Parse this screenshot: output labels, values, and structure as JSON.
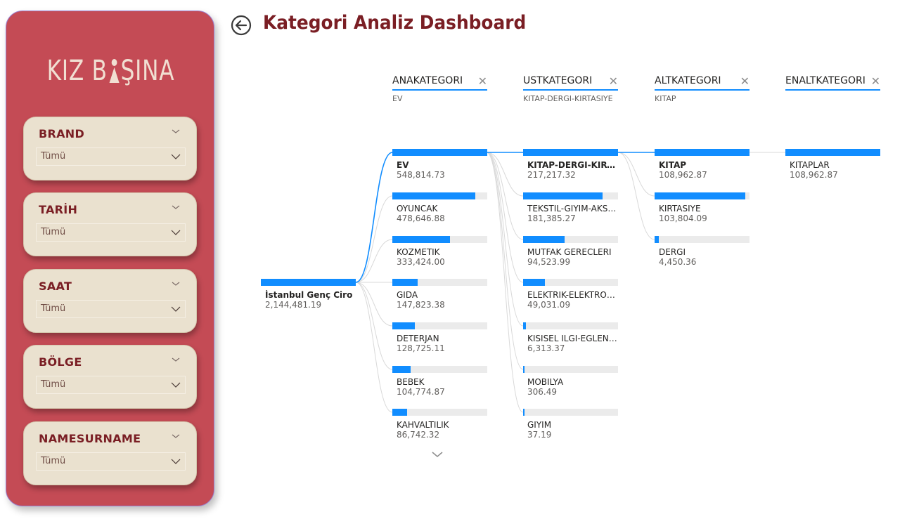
{
  "sidebar": {
    "logo_text_left": "KIZ B",
    "logo_text_right": "ŞINA",
    "slicers": [
      {
        "title": "BRAND",
        "value": "Tümü"
      },
      {
        "title": "TARİH",
        "value": "Tümü"
      },
      {
        "title": "SAAT",
        "value": "Tümü"
      },
      {
        "title": "BÖLGE",
        "value": "Tümü"
      },
      {
        "title": "NAMESURNAME",
        "value": "Tümü"
      }
    ]
  },
  "header": {
    "title": "Kategori Analiz Dashboard"
  },
  "tree": {
    "root": {
      "label": "İstanbul Genç Ciro",
      "value": "2,144,481.19",
      "fill": 1.0
    },
    "levels": [
      {
        "name": "ANAKATEGORI",
        "selected": "EV"
      },
      {
        "name": "USTKATEGORI",
        "selected": "KITAP-DERGI-KIRTASIYE"
      },
      {
        "name": "ALTKATEGORI",
        "selected": "KITAP"
      },
      {
        "name": "ENALTKATEGORI",
        "selected": ""
      }
    ],
    "ana": [
      {
        "label": "EV",
        "value": "548,814.73",
        "fill": 1.0,
        "selected": true
      },
      {
        "label": "OYUNCAK",
        "value": "478,646.88",
        "fill": 0.872
      },
      {
        "label": "KOZMETIK",
        "value": "333,424.00",
        "fill": 0.608
      },
      {
        "label": "GIDA",
        "value": "147,823.38",
        "fill": 0.269
      },
      {
        "label": "DETERJAN",
        "value": "128,725.11",
        "fill": 0.235
      },
      {
        "label": "BEBEK",
        "value": "104,774.87",
        "fill": 0.191
      },
      {
        "label": "KAHVALTILIK",
        "value": "86,742.32",
        "fill": 0.158
      }
    ],
    "ust": [
      {
        "label": "KITAP-DERGI-KIRTA...",
        "value": "217,217.32",
        "fill": 1.0,
        "selected": true
      },
      {
        "label": "TEKSTIL-GIYIM-AKSES...",
        "value": "181,385.27",
        "fill": 0.835
      },
      {
        "label": "MUTFAK GERECLERI",
        "value": "94,523.99",
        "fill": 0.435
      },
      {
        "label": "ELEKTRIK-ELEKTRONIK",
        "value": "49,031.09",
        "fill": 0.226
      },
      {
        "label": "KISISEL ILGI-EGLENCE",
        "value": "6,313.37",
        "fill": 0.029
      },
      {
        "label": "MOBILYA",
        "value": "306.49",
        "fill": 0.0014
      },
      {
        "label": "GIYIM",
        "value": "37.19",
        "fill": 0.0002
      }
    ],
    "alt": [
      {
        "label": "KITAP",
        "value": "108,962.87",
        "fill": 1.0,
        "selected": true
      },
      {
        "label": "KIRTASIYE",
        "value": "103,804.09",
        "fill": 0.953
      },
      {
        "label": "DERGI",
        "value": "4,450.36",
        "fill": 0.041
      }
    ],
    "enalt": [
      {
        "label": "KITAPLAR",
        "value": "108,962.87",
        "fill": 1.0
      }
    ]
  },
  "colors": {
    "accent": "#118dff",
    "sidebar": "#c44b55",
    "title": "#7a1e24",
    "card": "#eae1cf"
  }
}
